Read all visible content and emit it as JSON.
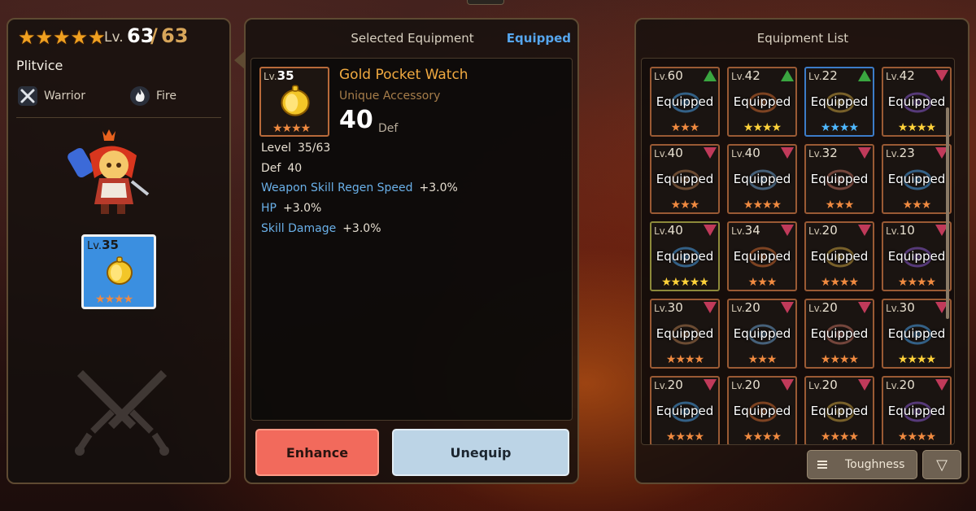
{
  "hero": {
    "stars": 5,
    "level_label": "Lv.",
    "level": "63",
    "max_level": "63",
    "name": "Plitvice",
    "class": "Warrior",
    "element": "Fire"
  },
  "equipped_slot": {
    "level_prefix": "Lv.",
    "level": "35",
    "stars": "★★★★"
  },
  "selected": {
    "title": "Selected Equipment",
    "status": "Equipped",
    "level_prefix": "Lv.",
    "level": "35",
    "stars": "★★★★",
    "name": "Gold Pocket Watch",
    "type": "Unique Accessory",
    "main_value": "40",
    "main_unit": "Def",
    "stats": [
      {
        "key": "Level",
        "value": "35/63"
      },
      {
        "key": "Def",
        "value": "40"
      },
      {
        "key": "Weapon Skill Regen Speed",
        "value": "+3.0%"
      },
      {
        "key": "HP",
        "value": "+3.0%"
      },
      {
        "key": "Skill Damage",
        "value": "+3.0%"
      }
    ],
    "enhance_label": "Enhance",
    "unequip_label": "Unequip"
  },
  "list": {
    "title": "Equipment List",
    "sort_label": "Toughness",
    "filter_icon": "▽",
    "items": [
      {
        "lv": "60",
        "status": "Equipped",
        "stars": "★★★",
        "arrow": "up"
      },
      {
        "lv": "42",
        "status": "Equipped",
        "stars": "★★★★",
        "arrow": "up"
      },
      {
        "lv": "22",
        "status": "Equipped",
        "stars": "★★★★",
        "arrow": "up"
      },
      {
        "lv": "42",
        "status": "Equipped",
        "stars": "★★★★",
        "arrow": "down"
      },
      {
        "lv": "40",
        "status": "Equipped",
        "stars": "★★★",
        "arrow": "down"
      },
      {
        "lv": "40",
        "status": "Equipped",
        "stars": "★★★★",
        "arrow": "down"
      },
      {
        "lv": "32",
        "status": "Equipped",
        "stars": "★★★",
        "arrow": "down"
      },
      {
        "lv": "23",
        "status": "Equipped",
        "stars": "★★★",
        "arrow": "down"
      },
      {
        "lv": "40",
        "status": "Equipped",
        "stars": "★★★★★",
        "arrow": "down"
      },
      {
        "lv": "34",
        "status": "Equipped",
        "stars": "★★★",
        "arrow": "down"
      },
      {
        "lv": "20",
        "status": "Equipped",
        "stars": "★★★★",
        "arrow": "down"
      },
      {
        "lv": "10",
        "status": "Equipped",
        "stars": "★★★★",
        "arrow": "down"
      },
      {
        "lv": "30",
        "status": "Equipped",
        "stars": "★★★★",
        "arrow": "down"
      },
      {
        "lv": "20",
        "status": "Equipped",
        "stars": "★★★",
        "arrow": "down"
      },
      {
        "lv": "20",
        "status": "Equipped",
        "stars": "★★★★",
        "arrow": "down"
      },
      {
        "lv": "30",
        "status": "Equipped",
        "stars": "★★★★",
        "arrow": "down"
      },
      {
        "lv": "20",
        "status": "Equipped",
        "stars": "★★★★",
        "arrow": "down"
      },
      {
        "lv": "20",
        "status": "Equipped",
        "stars": "★★★★",
        "arrow": "down"
      },
      {
        "lv": "20",
        "status": "Equipped",
        "stars": "★★★★",
        "arrow": "down"
      },
      {
        "lv": "20",
        "status": "Equipped",
        "stars": "★★★★",
        "arrow": "down"
      }
    ]
  },
  "colors": {
    "accent_blue": "#56a6ee",
    "item_name": "#f0a940",
    "enhance": "#f26a5c",
    "unequip": "#bcd4e6"
  }
}
